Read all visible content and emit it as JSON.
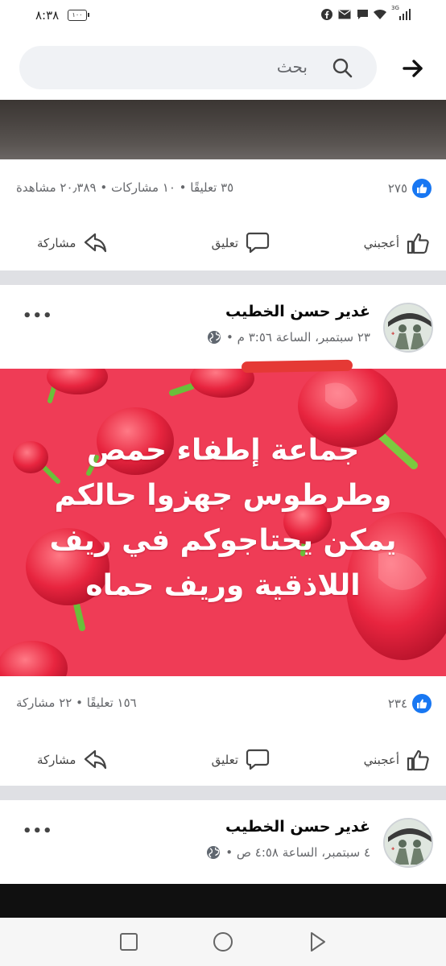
{
  "status_bar": {
    "time": "٨:٣٨",
    "battery": "١٠٠",
    "network": "3G",
    "icons": [
      "facebook-icon",
      "mail-icon",
      "message-icon",
      "wifi-icon",
      "signal-icon"
    ]
  },
  "search": {
    "placeholder": "بحث",
    "icon": "search-icon",
    "back_icon": "arrow-right-icon"
  },
  "post1": {
    "likes_count": "٢٧٥",
    "meta": "٣٥ تعليقًا • ١٠ مشاركات • ٢٠٫٣٨٩ مشاهدة"
  },
  "actions": {
    "like": "أعجبني",
    "comment": "تعليق",
    "share": "مشاركة"
  },
  "post2": {
    "author": "غدير حسن الخطيب",
    "time": "٢٣ سبتمبر، الساعة ٣:٥٦ م •",
    "caption_lines": [
      "جماعة إطفاء حمص",
      "وطرطوس جهزوا حالكم",
      "يمكن يحتاجوكم في ريف",
      "اللاذقية وريف حماه"
    ],
    "likes_count": "٢٣٤",
    "meta": "١٥٦ تعليقًا • ٢٢ مشاركة",
    "more_label": "•••"
  },
  "post3": {
    "author": "غدير حسن الخطيب",
    "time": "٤ سبتمبر، الساعة ٤:٥٨ ص •",
    "more_label": "•••"
  },
  "colors": {
    "facebook_blue": "#1877f2",
    "image_background": "#ef3c56",
    "separator": "#dfe0e4",
    "secondary_text": "#65676b"
  },
  "navigation": {
    "buttons": [
      "recent-apps-button",
      "home-button",
      "back-button"
    ]
  }
}
